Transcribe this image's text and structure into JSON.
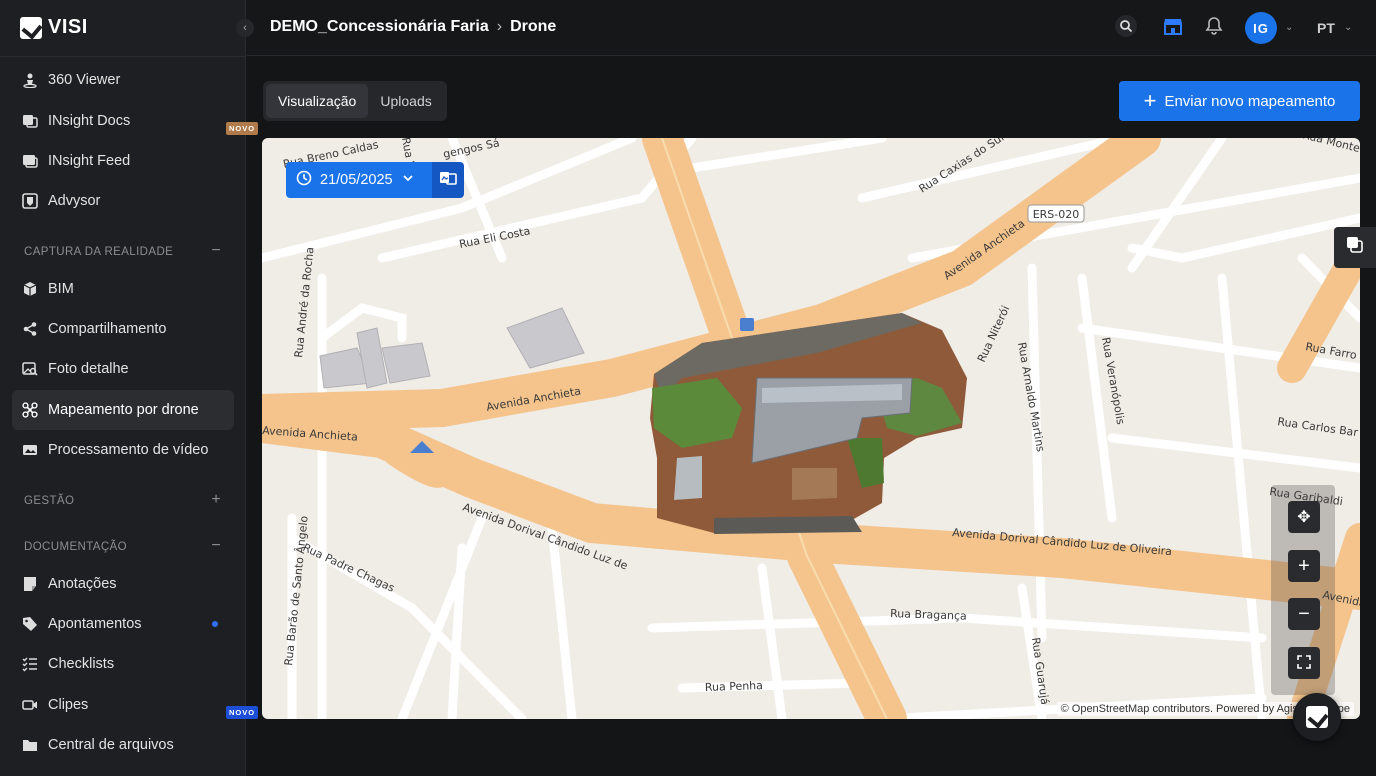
{
  "app": {
    "name": "VISI"
  },
  "sidebar": {
    "items_top": [
      {
        "label": "360 Viewer",
        "icon": "person-pin-icon"
      },
      {
        "label": "INsight Docs",
        "icon": "docs-icon",
        "badge": "NOVO"
      },
      {
        "label": "INsight Feed",
        "icon": "feed-icon"
      },
      {
        "label": "Advysor",
        "icon": "advysor-icon"
      }
    ],
    "sections": [
      {
        "title": "CAPTURA DA REALIDADE",
        "toggle": "−",
        "items": [
          {
            "label": "BIM",
            "icon": "cube-icon"
          },
          {
            "label": "Compartilhamento",
            "icon": "share-icon"
          },
          {
            "label": "Foto detalhe",
            "icon": "photo-search-icon"
          },
          {
            "label": "Mapeamento por drone",
            "icon": "drone-icon",
            "active": true
          },
          {
            "label": "Processamento de vídeo",
            "icon": "video-image-icon"
          }
        ]
      },
      {
        "title": "GESTÃO",
        "toggle": "+",
        "items": []
      },
      {
        "title": "DOCUMENTAÇÃO",
        "toggle": "−",
        "items": [
          {
            "label": "Anotações",
            "icon": "notes-icon"
          },
          {
            "label": "Apontamentos",
            "icon": "tag-icon",
            "dot": true
          },
          {
            "label": "Checklists",
            "icon": "checklist-icon"
          },
          {
            "label": "Clipes",
            "icon": "video-clip-icon",
            "badge": "NOVO"
          },
          {
            "label": "Central de arquivos",
            "icon": "folder-icon"
          }
        ]
      }
    ]
  },
  "header": {
    "breadcrumb": [
      "DEMO_Concessionária Faria",
      "Drone"
    ],
    "separator": "›",
    "avatar_initials": "IG",
    "language": "PT"
  },
  "main": {
    "tabs": [
      {
        "label": "Visualização",
        "active": true
      },
      {
        "label": "Uploads",
        "active": false
      }
    ],
    "upload_button": "Enviar novo mapeamento"
  },
  "map": {
    "date": "21/05/2025",
    "attribution_prefix": "© ",
    "attribution_osm": "OpenStreetMap",
    "attribution_rest": " contributors. Powered by Agisoft",
    "attribution_tail": "pe",
    "route_shield": "ERS-020",
    "streets": [
      "Rua Breno Caldas",
      "Rua Caxias do Sul",
      "Rua Eli Costa",
      "Avenida Anchieta",
      "Avenida Anchieta",
      "Avenida Anchieta",
      "Rua Niterói",
      "Rua Arnaldo Martins",
      "Rua Veranópolis",
      "Rua Farro",
      "Rua Carlos Bar",
      "Rua Garibaldi",
      "Avenida Dorival Cândido Luz de",
      "Avenida Dorival Cândido Luz de Oliveira",
      "Avenida Do",
      "Rua Padre Chagas",
      "Rua Bragança",
      "Rua Penha",
      "Rua Barão de Santo Ângelo",
      "Rua André da Rocha",
      "Rua Guarujá",
      "Rua Monte",
      "Rua Vera",
      "gengos Sá"
    ]
  },
  "colors": {
    "accent": "#1a73e8",
    "sidebar_bg": "#1e1f22",
    "page_bg": "#141517",
    "road": "#f5c98f"
  }
}
